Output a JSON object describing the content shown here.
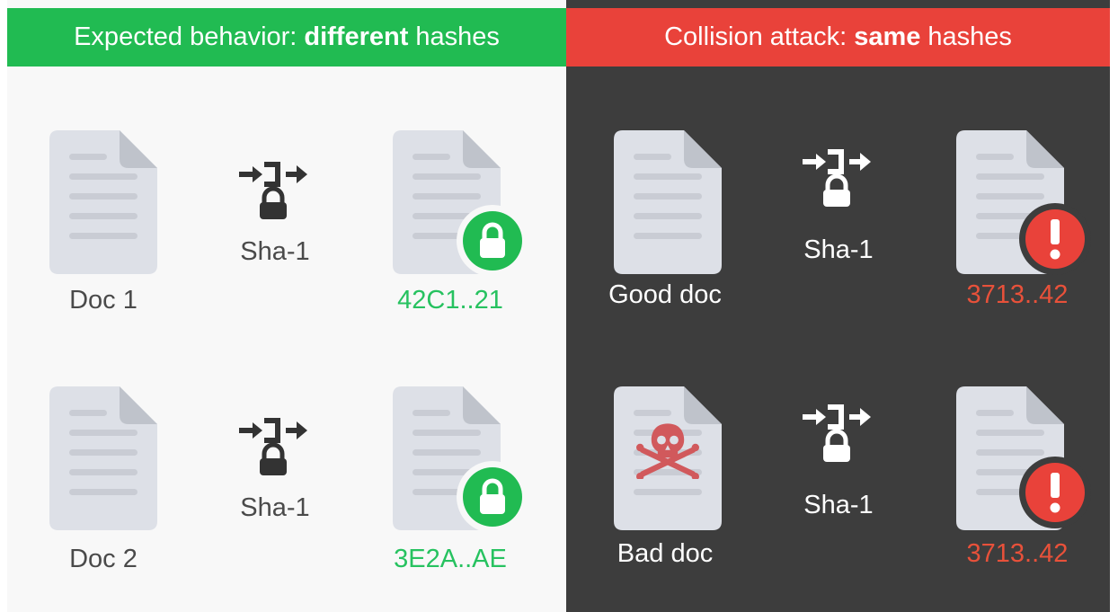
{
  "left": {
    "header_prefix": "Expected behavior:",
    "header_bold": "different",
    "header_suffix": "hashes",
    "rows": [
      {
        "doc_label": "Doc 1",
        "algo": "Sha-1",
        "hash": "42C1..21"
      },
      {
        "doc_label": "Doc 2",
        "algo": "Sha-1",
        "hash": "3E2A..AE"
      }
    ]
  },
  "right": {
    "header_prefix": "Collision attack:",
    "header_bold": "same",
    "header_suffix": "hashes",
    "rows": [
      {
        "doc_label": "Good doc",
        "algo": "Sha-1",
        "hash": "3713..42"
      },
      {
        "doc_label": "Bad doc",
        "algo": "Sha-1",
        "hash": "3713..42"
      }
    ]
  },
  "icons": {
    "document": "document-icon",
    "hash_function": "hash-function-icon",
    "lock_badge": "lock-badge-icon",
    "warning_badge": "exclamation-badge-icon",
    "skull": "skull-crossbones-icon"
  },
  "colors": {
    "good": "#21bb52",
    "bad": "#e9423a",
    "good_hash_text": "#27c260",
    "bad_hash_text": "#e8513a",
    "dark_bg": "#3d3d3d",
    "light_bg": "#f8f8f8"
  }
}
